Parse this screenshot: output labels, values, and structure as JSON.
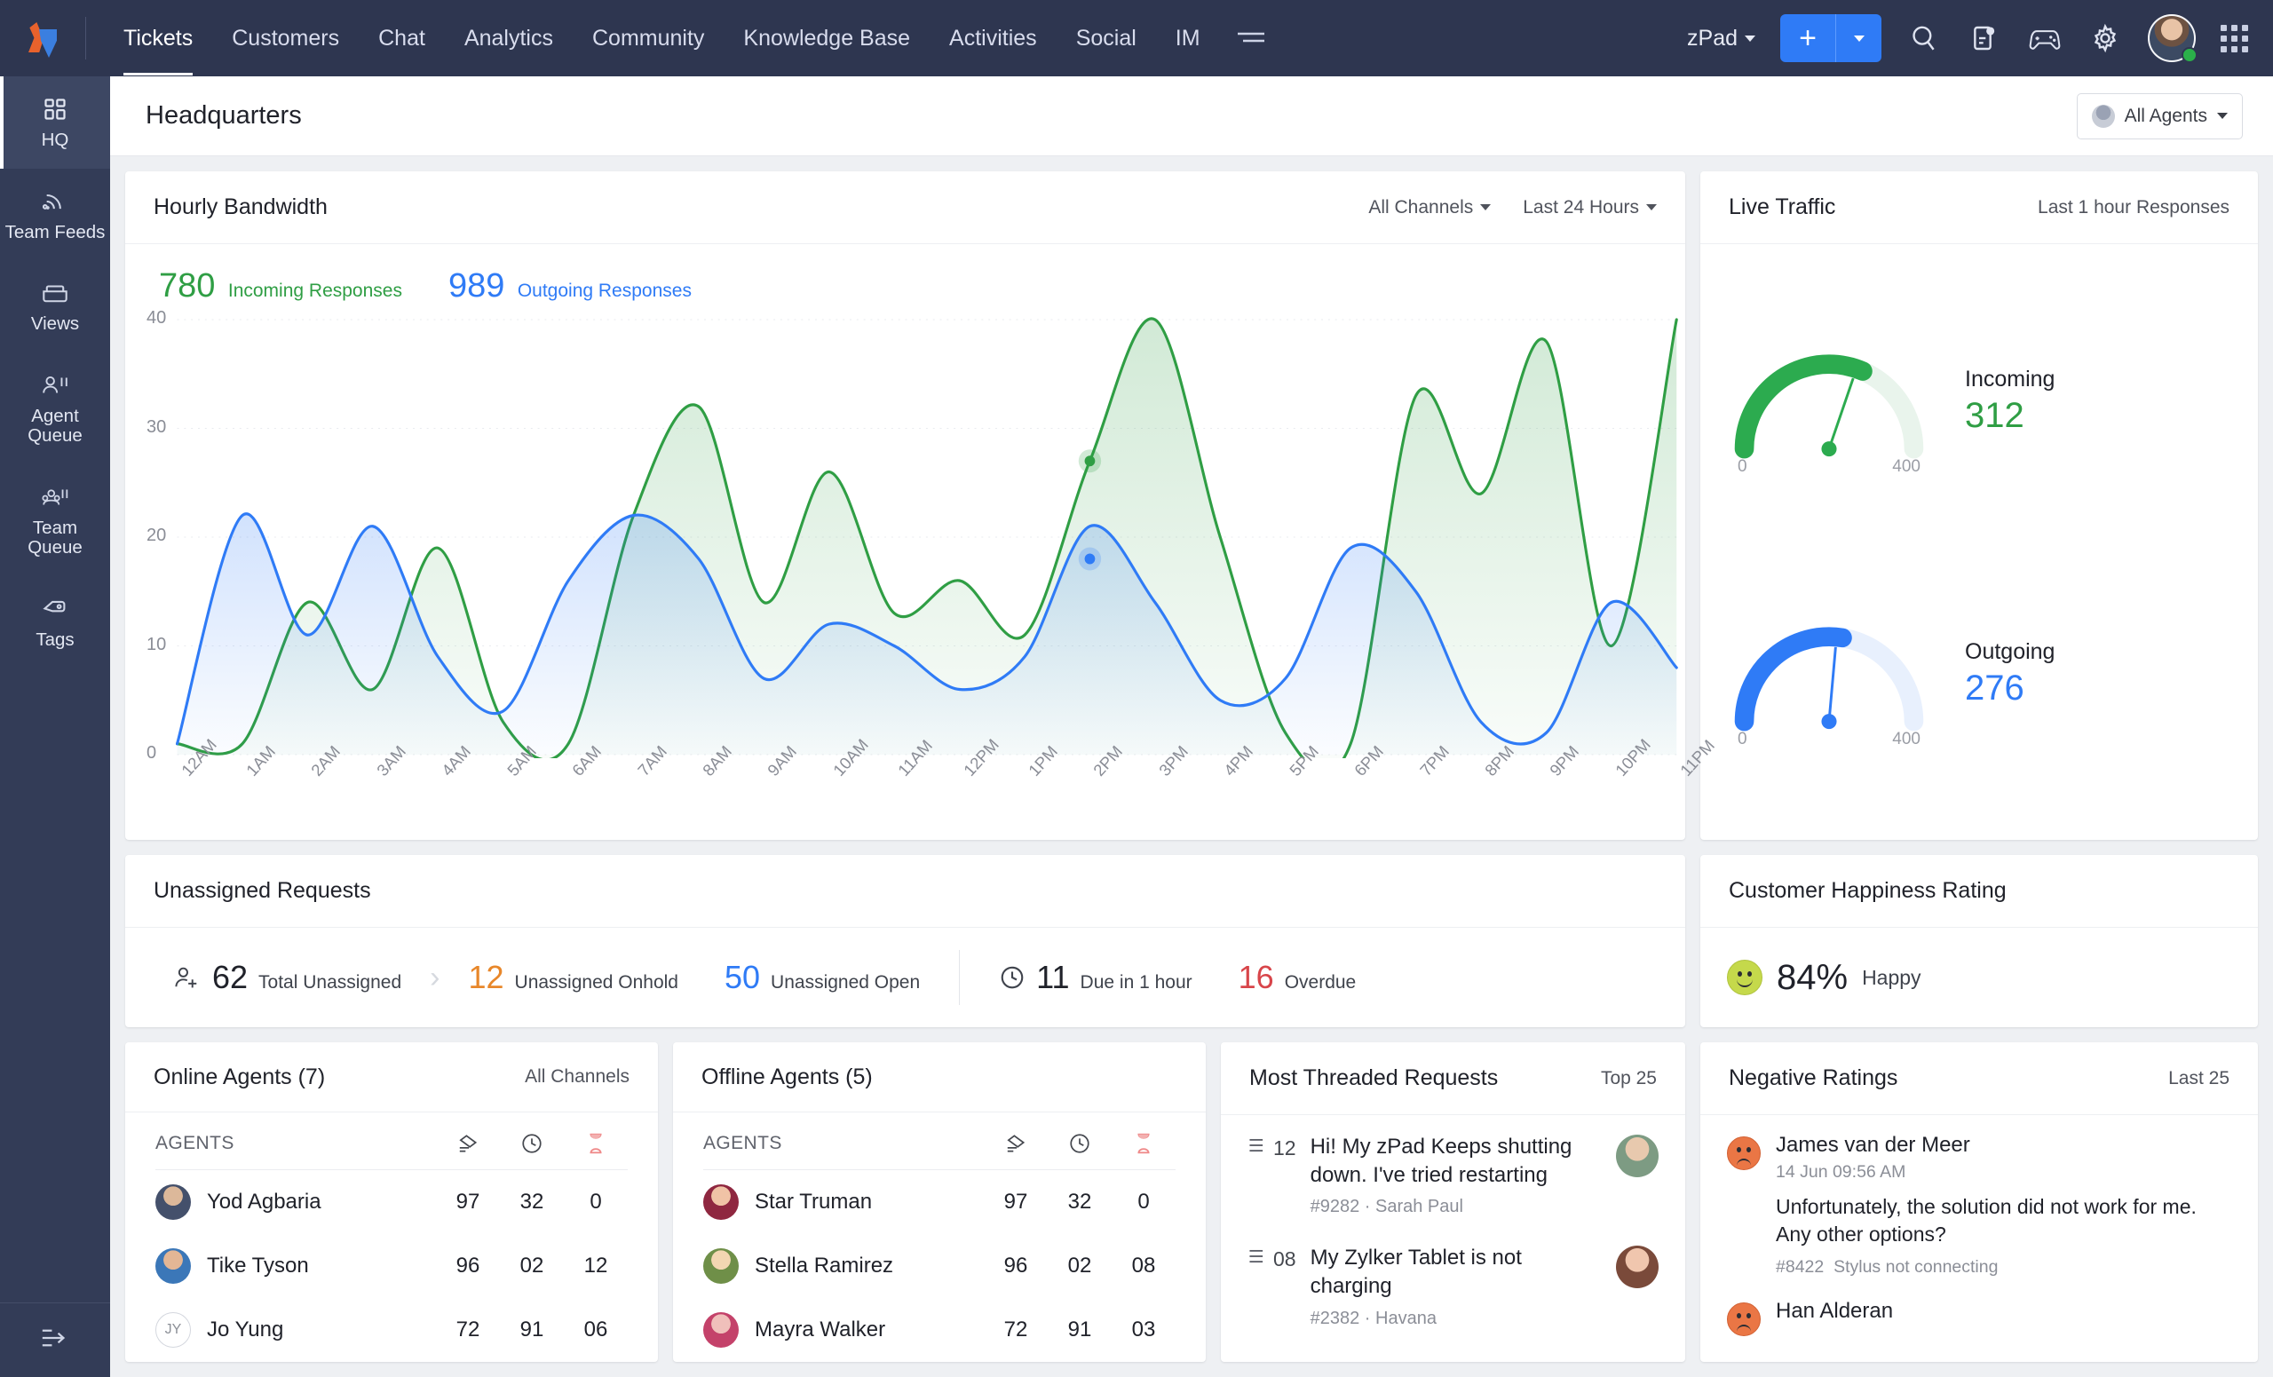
{
  "topnav": {
    "logo_name": "zylker-logo",
    "items": [
      {
        "label": "Tickets",
        "active": true
      },
      {
        "label": "Customers",
        "active": false
      },
      {
        "label": "Chat",
        "active": false
      },
      {
        "label": "Analytics",
        "active": false
      },
      {
        "label": "Community",
        "active": false
      },
      {
        "label": "Knowledge Base",
        "active": false
      },
      {
        "label": "Activities",
        "active": false
      },
      {
        "label": "Social",
        "active": false
      },
      {
        "label": "IM",
        "active": false
      }
    ],
    "more_icon": "hamburger-icon",
    "department": "zPad",
    "new_button": "+",
    "icons": [
      "search-icon",
      "notes-icon",
      "game-controller-icon",
      "gear-icon",
      "user-avatar",
      "apps-grid-icon"
    ]
  },
  "sidebar": {
    "items": [
      {
        "label": "HQ",
        "icon": "dashboard-grid-icon",
        "active": true
      },
      {
        "label": "Team Feeds",
        "icon": "rss-feed-icon",
        "active": false
      },
      {
        "label": "Views",
        "icon": "folder-icon",
        "active": false
      },
      {
        "label": "Agent Queue",
        "icon": "agent-queue-icon",
        "active": false
      },
      {
        "label": "Team Queue",
        "icon": "team-queue-icon",
        "active": false
      },
      {
        "label": "Tags",
        "icon": "tag-icon",
        "active": false
      }
    ],
    "collapse_icon": "collapse-arrow-icon"
  },
  "page": {
    "title": "Headquarters",
    "agent_filter": "All Agents"
  },
  "bandwidth": {
    "title": "Hourly Bandwidth",
    "channel_filter": "All Channels",
    "time_filter": "Last 24 Hours",
    "incoming_total": "780",
    "incoming_label": "Incoming Responses",
    "outgoing_total": "989",
    "outgoing_label": "Outgoing Responses"
  },
  "chart_data": {
    "type": "area",
    "title": "Hourly Bandwidth",
    "xlabel": "",
    "ylabel": "",
    "ylim": [
      0,
      40
    ],
    "yticks": [
      0,
      10,
      20,
      30,
      40
    ],
    "grid": true,
    "legend_position": "top-left",
    "categories": [
      "12AM",
      "1AM",
      "2AM",
      "3AM",
      "4AM",
      "5AM",
      "6AM",
      "7AM",
      "8AM",
      "9AM",
      "10AM",
      "11AM",
      "12PM",
      "1PM",
      "2PM",
      "3PM",
      "4PM",
      "5PM",
      "6PM",
      "7PM",
      "8PM",
      "9PM",
      "10PM",
      "11PM"
    ],
    "series": [
      {
        "name": "Incoming Responses",
        "color": "#2f9e44",
        "values": [
          1,
          1,
          14,
          6,
          19,
          3,
          1,
          22,
          32,
          14,
          26,
          13,
          16,
          11,
          27,
          40,
          20,
          2,
          1,
          33,
          24,
          38,
          10,
          40
        ]
      },
      {
        "name": "Outgoing Responses",
        "color": "#2f7bf6",
        "values": [
          1,
          22,
          11,
          21,
          9,
          4,
          16,
          22,
          18,
          7,
          12,
          10,
          6,
          9,
          21,
          14,
          5,
          7,
          19,
          15,
          3,
          2,
          14,
          8
        ]
      }
    ],
    "markers": [
      {
        "series": "Incoming Responses",
        "x": "2PM",
        "value": 27
      },
      {
        "series": "Outgoing Responses",
        "x": "2PM",
        "value": 18
      }
    ]
  },
  "live_traffic": {
    "title": "Live Traffic",
    "subtitle": "Last 1 hour Responses",
    "gauges": [
      {
        "label": "Incoming",
        "value": "312",
        "min": "0",
        "max": "400",
        "color": "#2cab4f",
        "pct": 0.63
      },
      {
        "label": "Outgoing",
        "value": "276",
        "min": "0",
        "max": "400",
        "color": "#2f7bf6",
        "pct": 0.55
      }
    ]
  },
  "unassigned": {
    "title": "Unassigned Requests",
    "metrics": [
      {
        "num": "62",
        "label": "Total Unassigned",
        "color": "dark",
        "icon": "user-add-icon"
      },
      {
        "num": "12",
        "label": "Unassigned Onhold",
        "color": "orange",
        "icon": ""
      },
      {
        "num": "50",
        "label": "Unassigned Open",
        "color": "blue",
        "icon": ""
      },
      {
        "num": "11",
        "label": "Due in 1 hour",
        "color": "dark",
        "icon": "clock-icon"
      },
      {
        "num": "16",
        "label": "Overdue",
        "color": "red",
        "icon": ""
      }
    ]
  },
  "happiness": {
    "title": "Customer Happiness Rating",
    "icon": "happy-smiley-icon",
    "percent": "84%",
    "label": "Happy"
  },
  "online_agents": {
    "title": "Online Agents (7)",
    "filter": "All Channels",
    "col_agents": "AGENTS",
    "col_icons": [
      "ticket-icon",
      "clock-icon",
      "hourglass-icon"
    ],
    "rows": [
      {
        "name": "Yod Agbaria",
        "tickets": "97",
        "time": "32",
        "pending": "0",
        "avatar": "photo",
        "av1": "#44506b",
        "av2": "#dcb89a"
      },
      {
        "name": "Tike Tyson",
        "tickets": "96",
        "time": "02",
        "pending": "12",
        "avatar": "photo",
        "av1": "#3b77b8",
        "av2": "#e3b695"
      },
      {
        "name": "Jo Yung",
        "tickets": "72",
        "time": "91",
        "pending": "06",
        "avatar": "initials",
        "initials": "JY"
      }
    ]
  },
  "offline_agents": {
    "title": "Offline Agents (5)",
    "col_agents": "AGENTS",
    "col_icons": [
      "ticket-icon",
      "clock-icon",
      "hourglass-icon"
    ],
    "rows": [
      {
        "name": "Star Truman",
        "tickets": "97",
        "time": "32",
        "pending": "0",
        "avatar": "photo",
        "av1": "#8f2740",
        "av2": "#f0c3a6"
      },
      {
        "name": "Stella Ramirez",
        "tickets": "96",
        "time": "02",
        "pending": "08",
        "avatar": "photo",
        "av1": "#6f8f48",
        "av2": "#f3d6b2"
      },
      {
        "name": "Mayra Walker",
        "tickets": "72",
        "time": "91",
        "pending": "03",
        "avatar": "photo",
        "av1": "#c4426a",
        "av2": "#f0c0bb"
      }
    ]
  },
  "threaded": {
    "title": "Most Threaded Requests",
    "filter": "Top 25",
    "rows": [
      {
        "count": "12",
        "subject": "Hi! My zPad Keeps shutting down. I've tried restarting",
        "ticket": "#9282",
        "customer": "Sarah Paul",
        "av1": "#7d9b83",
        "av2": "#e8c9ae"
      },
      {
        "count": "08",
        "subject": "My Zylker Tablet is not charging",
        "ticket": "#2382",
        "customer": "Havana",
        "av1": "#7a4a3a",
        "av2": "#f0c6ae"
      }
    ]
  },
  "negative": {
    "title": "Negative Ratings",
    "filter": "Last 25",
    "rows": [
      {
        "name": "James van der Meer",
        "date": "14 Jun 09:56 AM",
        "text": "Unfortunately, the solution did not work for me. Any other options?",
        "ticket": "#8422",
        "subject": "Stylus not connecting"
      },
      {
        "name": "Han Alderan",
        "date": "",
        "text": "",
        "ticket": "",
        "subject": ""
      }
    ]
  },
  "colors": {
    "nav_bg": "#2e3650",
    "sidebar_bg": "#333c57",
    "accent_blue": "#2f7bf6",
    "accent_green": "#2f9e44",
    "orange": "#e8872a",
    "red": "#d8454a",
    "page_bg": "#eef0f3"
  }
}
